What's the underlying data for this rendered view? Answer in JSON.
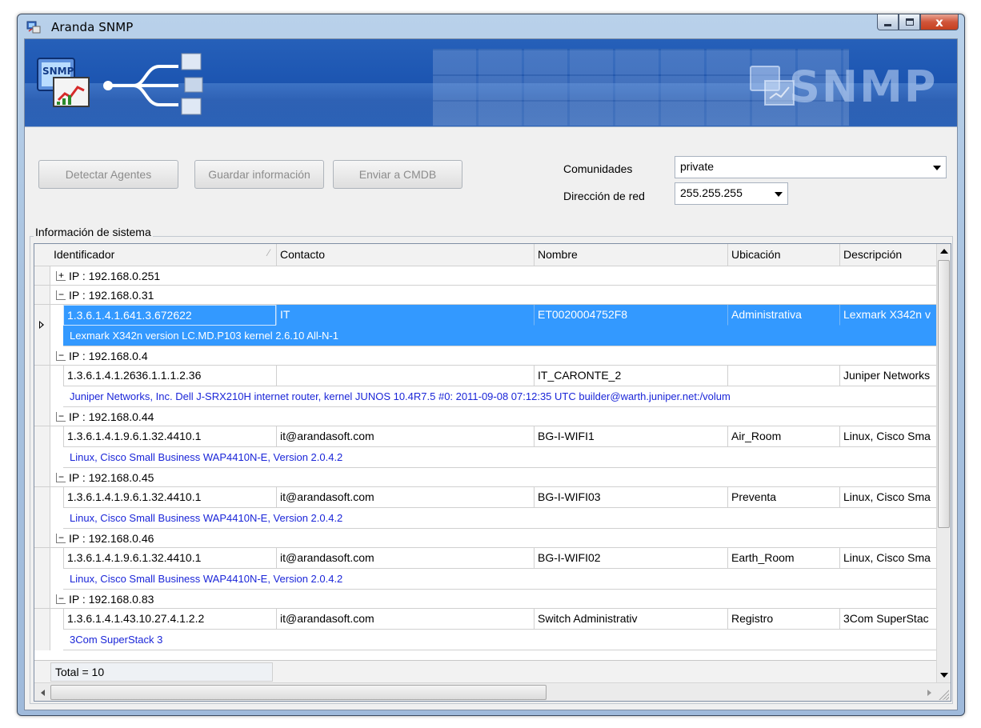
{
  "window": {
    "title": "Aranda SNMP",
    "close_glyph": "x"
  },
  "banner": {
    "logo_text": "SNMP",
    "brand_text": "SNMP"
  },
  "toolbar": {
    "detect_label": "Detectar Agentes",
    "save_label": "Guardar información",
    "send_label": "Enviar a CMDB",
    "communities_label": "Comunidades",
    "communities_value": "private",
    "network_label": "Dirección de red",
    "network_value": "255.255.255"
  },
  "system_info": {
    "group_label": "Información de sistema",
    "columns": [
      "Identificador",
      "Contacto",
      "Nombre",
      "Ubicación",
      "Descripción"
    ],
    "sort_glyph": "⁄",
    "groups": [
      {
        "label": "IP : 192.168.0.251",
        "expander": "+"
      },
      {
        "label": "IP : 192.168.0.31",
        "expander": "−",
        "id": "1.3.6.1.4.1.641.3.672622",
        "contact": "IT",
        "name": "ET0020004752F8",
        "location": "Administrativa",
        "description": "Lexmark X342n v",
        "detail": "Lexmark X342n version LC.MD.P103 kernel 2.6.10 All-N-1"
      },
      {
        "label": "IP : 192.168.0.4",
        "expander": "−",
        "id": "1.3.6.1.4.1.2636.1.1.1.2.36",
        "contact": "",
        "name": "IT_CARONTE_2",
        "location": "",
        "description": "Juniper Networks",
        "detail": "Juniper Networks, Inc. Dell J-SRX210H internet router, kernel JUNOS 10.4R7.5 #0: 2011-09-08 07:12:35 UTC     builder@warth.juniper.net:/volum"
      },
      {
        "label": "IP : 192.168.0.44",
        "expander": "−",
        "id": "1.3.6.1.4.1.9.6.1.32.4410.1",
        "contact": "it@arandasoft.com",
        "name": "BG-I-WIFI1",
        "location": "Air_Room",
        "description": "Linux, Cisco Sma",
        "detail": "Linux, Cisco Small Business WAP4410N-E, Version 2.0.4.2"
      },
      {
        "label": "IP : 192.168.0.45",
        "expander": "−",
        "id": "1.3.6.1.4.1.9.6.1.32.4410.1",
        "contact": "it@arandasoft.com",
        "name": "BG-I-WIFI03",
        "location": "Preventa",
        "description": "Linux, Cisco Sma",
        "detail": "Linux, Cisco Small Business WAP4410N-E, Version 2.0.4.2"
      },
      {
        "label": "IP : 192.168.0.46",
        "expander": "−",
        "id": "1.3.6.1.4.1.9.6.1.32.4410.1",
        "contact": "it@arandasoft.com",
        "name": "BG-I-WIFI02",
        "location": "Earth_Room",
        "description": "Linux, Cisco Sma",
        "detail": "Linux, Cisco Small Business WAP4410N-E, Version 2.0.4.2"
      },
      {
        "label": "IP : 192.168.0.83",
        "expander": "−",
        "id": "1.3.6.1.4.1.43.10.27.4.1.2.2",
        "contact": "it@arandasoft.com",
        "name": "Switch Administrativ",
        "location": "Registro",
        "description": "3Com SuperStac",
        "detail": "3Com SuperStack 3"
      }
    ],
    "total": "Total = 10"
  },
  "colors": {
    "selection": "#3399ff",
    "detail_text": "#1b26d8",
    "banner": "#1d56b2"
  },
  "icons": [
    "app-icon",
    "minimize-icon",
    "maximize-icon",
    "close-icon",
    "snmp-logo-icon",
    "network-icon",
    "dropdown-arrow-icon",
    "expand-icon",
    "collapse-icon",
    "row-pointer-icon",
    "scroll-up-icon",
    "scroll-down-icon",
    "scroll-left-icon",
    "scroll-right-icon",
    "resize-grip-icon"
  ]
}
